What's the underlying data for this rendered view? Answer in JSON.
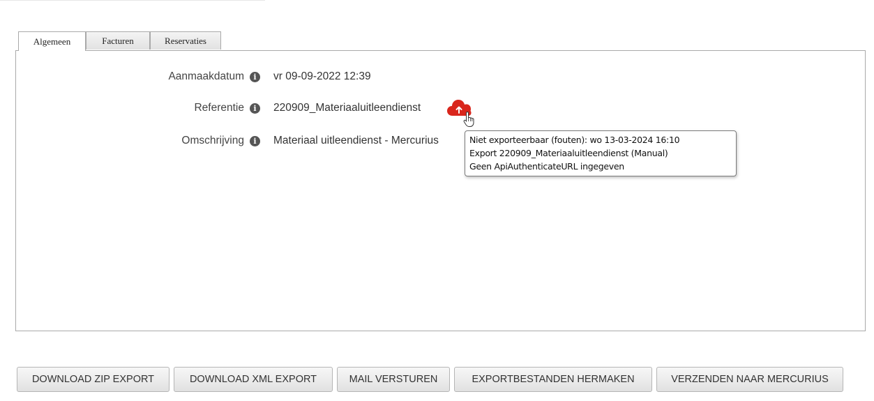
{
  "tabs": [
    "Algemeen",
    "Facturen",
    "Reservaties"
  ],
  "fields": {
    "aanmaakdatum": {
      "label": "Aanmaakdatum",
      "value": "vr 09-09-2022 12:39"
    },
    "referentie": {
      "label": "Referentie",
      "value": "220909_Materiaaluitleendienst"
    },
    "omschrijving": {
      "label": "Omschrijving",
      "value": "Materiaal uitleendienst - Mercurius"
    }
  },
  "info_icon_glyph": "i",
  "cloud_icon": {
    "name": "cloud-upload-icon",
    "color": "#d9261c"
  },
  "tooltip": {
    "line1": "Niet exporteerbaar (fouten): wo 13-03-2024 16:10",
    "line2": "Export 220909_Materiaaluitleendienst (Manual)",
    "line3": "Geen ApiAuthenticateURL ingegeven"
  },
  "buttons": {
    "download_zip": "DOWNLOAD ZIP EXPORT",
    "download_xml": "DOWNLOAD XML EXPORT",
    "mail": "MAIL VERSTUREN",
    "rebuild": "EXPORTBESTANDEN HERMAKEN",
    "send": "VERZENDEN NAAR MERCURIUS"
  }
}
